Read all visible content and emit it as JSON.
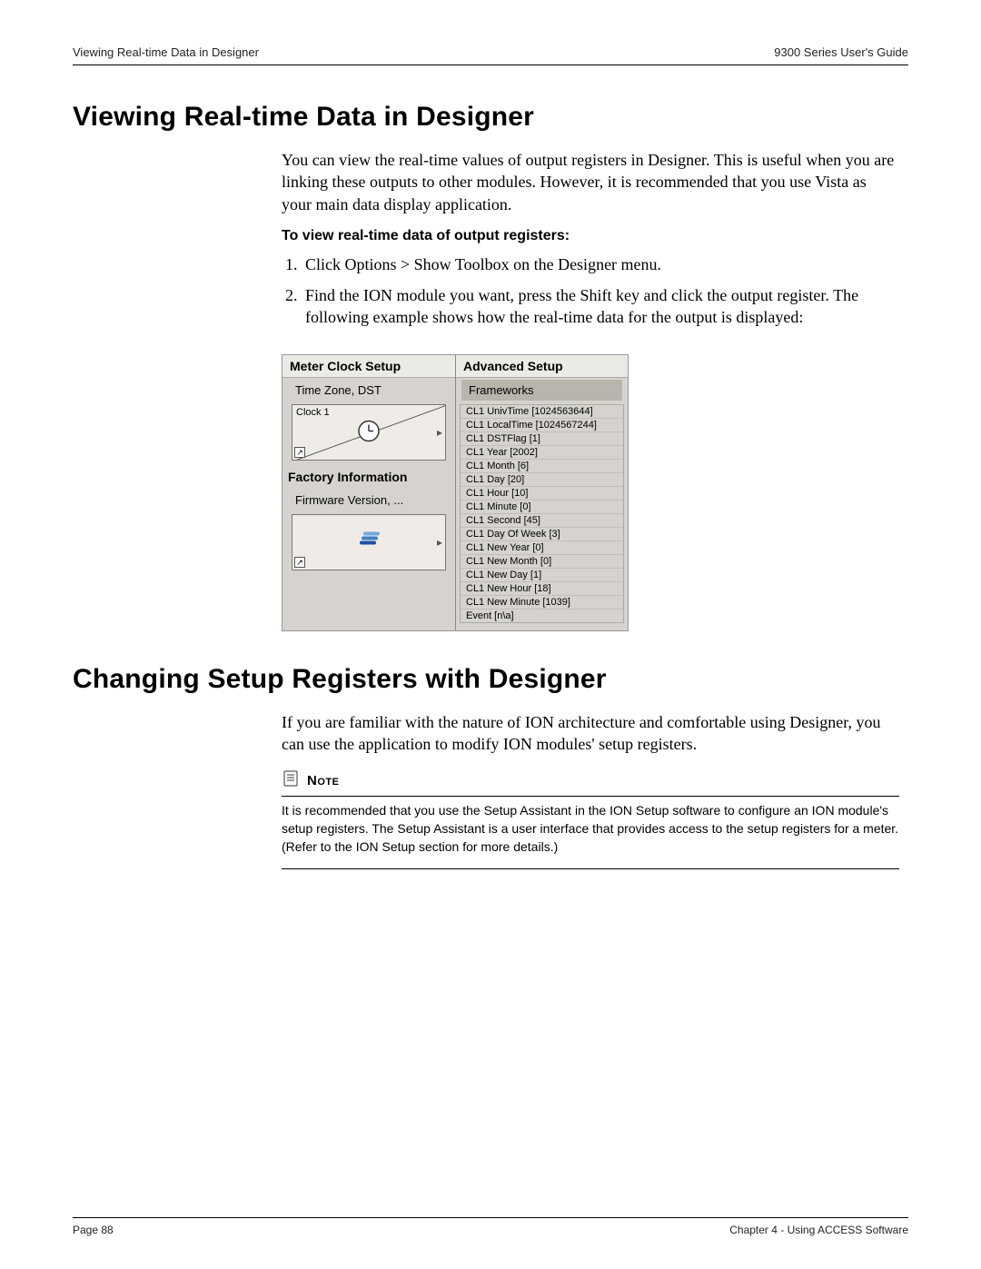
{
  "header": {
    "left": "Viewing Real-time Data in Designer",
    "right": "9300 Series User's Guide"
  },
  "section1": {
    "title": "Viewing Real-time Data in Designer",
    "intro": "You can view the real-time values of output registers in Designer. This is useful when you are linking these outputs to other modules. However, it is recommended that you use Vista as your main data display application.",
    "subhead": "To view real-time data of output registers:",
    "steps": [
      "Click Options > Show Toolbox on the Designer menu.",
      "Find the ION module you want, press the Shift key and click the output register. The following example shows how the real-time data for the output is displayed:"
    ]
  },
  "panel": {
    "left_title": "Meter Clock Setup",
    "right_title": "Advanced Setup",
    "left_item1": "Time Zone, DST",
    "left_module_label": "Clock 1",
    "left_section2": "Factory Information",
    "left_item2": "Firmware Version, ...",
    "right_item1": "Frameworks",
    "registers": [
      "CL1 UnivTime [1024563644]",
      "CL1 LocalTime [1024567244]",
      "CL1 DSTFlag [1]",
      "CL1 Year [2002]",
      "CL1 Month [6]",
      "CL1 Day [20]",
      "CL1 Hour [10]",
      "CL1 Minute [0]",
      "CL1 Second [45]",
      "CL1 Day Of Week [3]",
      "CL1 New Year [0]",
      "CL1 New Month [0]",
      "CL1 New Day [1]",
      "CL1 New Hour [18]",
      "CL1 New Minute [1039]",
      "Event [n\\a]"
    ]
  },
  "section2": {
    "title": "Changing Setup Registers with Designer",
    "intro": "If you are familiar with the nature of ION architecture and comfortable using Designer, you can use the application to modify ION modules' setup registers."
  },
  "note": {
    "label": "Note",
    "body": "It is recommended that you use the Setup Assistant in the ION Setup software to configure an ION module's setup registers. The Setup Assistant is a user interface that provides access to the setup registers for a meter. (Refer to the ION Setup section for more details.)"
  },
  "footer": {
    "left": "Page 88",
    "right": "Chapter 4 - Using ACCESS Software"
  }
}
